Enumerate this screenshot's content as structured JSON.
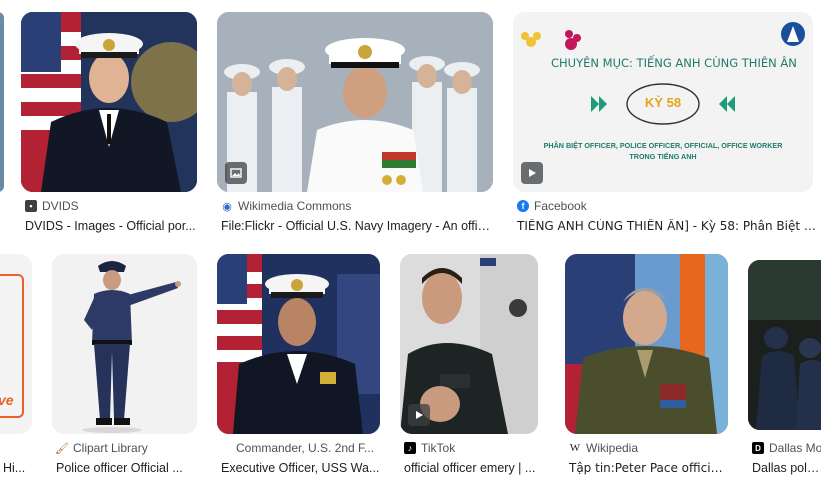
{
  "row1": [
    {
      "source": "DVIDS",
      "caption": "DVIDS - Images - Official por...",
      "badge": ""
    },
    {
      "source": "Wikimedia Commons",
      "caption": "File:Flickr - Official U.S. Navy Imagery - An offic...",
      "badge": "image"
    },
    {
      "source": "Facebook",
      "caption": "TIẾNG ANH CÙNG THIÊN ÂN] - Kỳ 58: Phân Biệt Off...",
      "badge": "play"
    }
  ],
  "row2": [
    {
      "source": "",
      "caption": "Hi...",
      "badge": ""
    },
    {
      "source": "Clipart Library",
      "caption": "Police officer Official ...",
      "badge": ""
    },
    {
      "source": "Commander, U.S. 2nd F...",
      "caption": "Executive Officer, USS Wa...",
      "badge": ""
    },
    {
      "source": "TikTok",
      "caption": "official officer emery | ...",
      "badge": "play"
    },
    {
      "source": "Wikipedia",
      "caption": "Tập tin:Peter Pace official ...",
      "badge": ""
    },
    {
      "source": "Dallas Mo",
      "caption": "Dallas police",
      "badge": ""
    }
  ],
  "fb_graphic": {
    "heading": "CHUYÊN MỤC: TIẾNG ANH CÙNG THIÊN ÂN",
    "episode": "KỲ 58",
    "subtitle_line1": "PHÂN BIỆT OFFICER, POLICE OFFICER, OFFICIAL, OFFICE WORKER",
    "subtitle_line2": "TRONG TIẾNG ANH",
    "accent_color": "#1f9a7a",
    "episode_color": "#e8a317"
  },
  "edge_thumb_text": "ve",
  "colors": {
    "caption": "#202124",
    "source": "#4d5156",
    "facebook_blue": "#1877f2"
  }
}
